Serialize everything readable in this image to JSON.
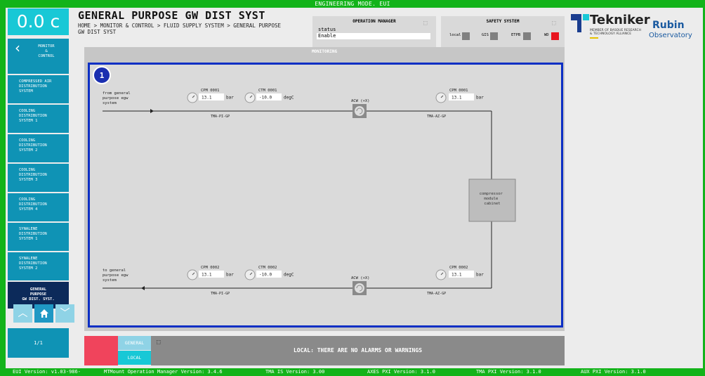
{
  "topbar": {
    "title": "ENGINEERING MODE. EUI"
  },
  "sidebar": {
    "temperature": "0.0 c",
    "back_label": "MONITOR\n&\nCONTROL",
    "items": [
      {
        "label": "COMPRESSED AIR\nDISTRIBUTION\nSYSTEM"
      },
      {
        "label": "COOLING\nDISTRIBUTION\nSYSTEM 1"
      },
      {
        "label": "COOLING\nDISTRIBUTION\nSYSTEM 2"
      },
      {
        "label": "COOLING\nDISTRIBUTION\nSYSTEM 3"
      },
      {
        "label": "COOLING\nDISTRIBUTION\nSYSTEM 4"
      },
      {
        "label": "SYNALENE\nDISTRIBUTION\nSYSTEM 1"
      },
      {
        "label": "SYNALENE\nDISTRIBUTION\nSYSTEM 2"
      }
    ],
    "active_label": "GENERAL\nPURPOSE\nGW DIST. SYST.",
    "pager": "1/1"
  },
  "header": {
    "title": "GENERAL PURPOSE GW DIST SYST",
    "breadcrumb": "HOME > MONITOR & CONTROL > FLUID SUPPLY SYSTEM > GENERAL PURPOSE GW DIST SYST"
  },
  "operation_manager": {
    "title": "OPERATION MANAGER",
    "status_label": "status",
    "status_value": "Enable"
  },
  "safety_system": {
    "title": "SAFETY SYSTEM",
    "flags": [
      {
        "label": "local",
        "color": "#808080"
      },
      {
        "label": "GIS",
        "color": "#808080"
      },
      {
        "label": "ETPB",
        "color": "#808080"
      },
      {
        "label": "WD",
        "color": "#e8141e"
      }
    ]
  },
  "logos": {
    "tekniker": "Tekniker",
    "tekniker_sub": "MEMBER OF BASQUE RESEARCH\n& TECHNOLOGY ALLIANCE",
    "rubin": "Rubin",
    "rubin_sub": "Observatory"
  },
  "monitoring": {
    "title": "MONITORING",
    "badge": "1",
    "supply_text": "from general\npurpose egw\nsystem",
    "return_text": "to general\npurpose egw\nsystem",
    "cabinet": "compressor\nmodule\ncabinet",
    "top": {
      "cpm_left": {
        "name": "CPM 0001",
        "value": "13.1",
        "unit": "bar"
      },
      "ctm": {
        "name": "CTM 0001",
        "value": "-10.0",
        "unit": "degC"
      },
      "acw": "ACW (+X)",
      "cpm_right": {
        "name": "CPM 0001",
        "value": "13.1",
        "unit": "bar"
      },
      "tag_left": "TMA-PI-GP",
      "tag_right": "TMA-AZ-GP"
    },
    "bottom": {
      "cpm_left": {
        "name": "CPM 0002",
        "value": "13.1",
        "unit": "bar"
      },
      "ctm": {
        "name": "CTM 0002",
        "value": "-10.0",
        "unit": "degC"
      },
      "acw": "ACW (+X)",
      "cpm_right": {
        "name": "CPM 0002",
        "value": "13.1",
        "unit": "bar"
      },
      "tag_left": "TMA-PI-GP",
      "tag_right": "TMA-AZ-GP"
    }
  },
  "alarms": {
    "tab_general": "GENERAL",
    "tab_local": "LOCAL",
    "message": "LOCAL: THERE ARE NO ALARMS OR WARNINGS"
  },
  "footer": {
    "eui": "EUI Version: v1.03-986-",
    "mtmount": "MTMount Operation Manager Version: 3.4.6",
    "tma_is": "TMA IS Version: 3.00",
    "axes": "AXES PXI Version: 3.1.0",
    "tma_pxi": "TMA PXI Version: 3.1.0",
    "aux": "AUX PXI Version: 3.1.0"
  }
}
